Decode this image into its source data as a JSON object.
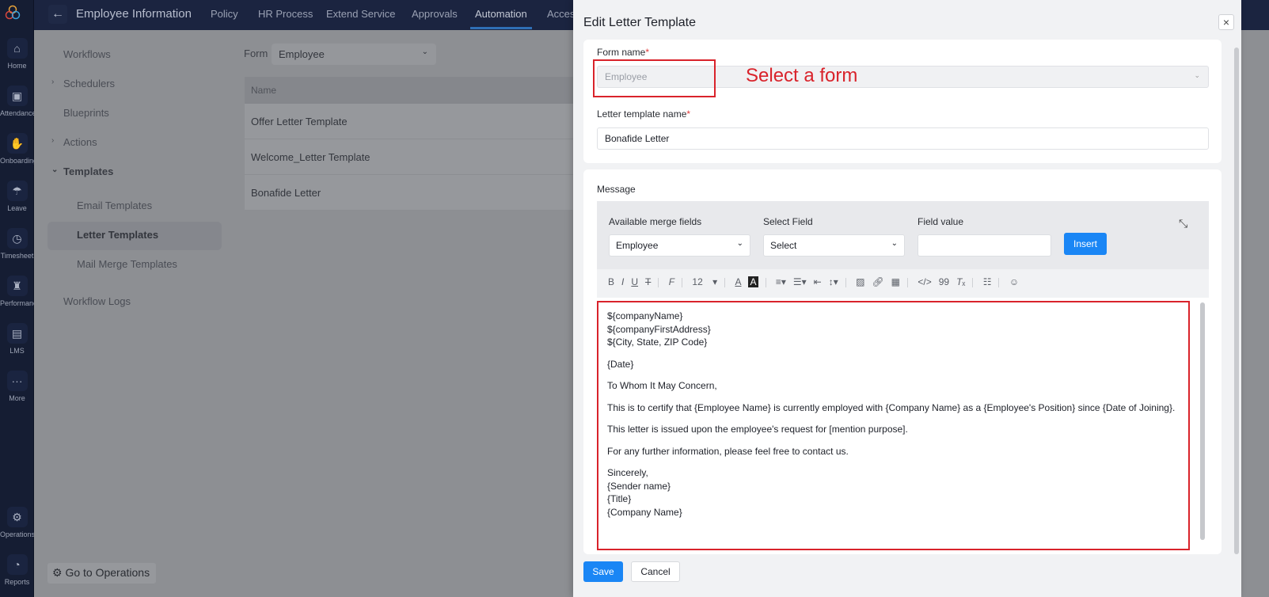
{
  "rail": [
    {
      "label": "Home",
      "icon": "home-icon",
      "glyph": "⌂"
    },
    {
      "label": "Attendance",
      "icon": "calendar-icon",
      "glyph": "▣"
    },
    {
      "label": "Onboarding",
      "icon": "handshake-icon",
      "glyph": "✋"
    },
    {
      "label": "Leave",
      "icon": "umbrella-icon",
      "glyph": "☂"
    },
    {
      "label": "Timesheet",
      "icon": "timer-icon",
      "glyph": "◷"
    },
    {
      "label": "Performance",
      "icon": "trophy-icon",
      "glyph": "♜"
    },
    {
      "label": "LMS",
      "icon": "lms-icon",
      "glyph": "▤"
    },
    {
      "label": "More",
      "icon": "more-icon",
      "glyph": "···"
    },
    {
      "label": "Operations",
      "icon": "operations-icon",
      "glyph": "⚙"
    },
    {
      "label": "Reports",
      "icon": "reports-icon",
      "glyph": "◔"
    }
  ],
  "topbar": {
    "title": "Employee Information",
    "tabs": [
      "Policy",
      "HR Process",
      "Extend Service",
      "Approvals",
      "Automation",
      "Access"
    ],
    "active": "Automation"
  },
  "nav": {
    "workflows": "Workflows",
    "schedulers": "Schedulers",
    "blueprints": "Blueprints",
    "actions": "Actions",
    "templates": "Templates",
    "email": "Email Templates",
    "letter": "Letter Templates",
    "mailmerge": "Mail Merge Templates",
    "logs": "Workflow Logs",
    "go_ops": "Go to Operations"
  },
  "main": {
    "form_label": "Form",
    "form_value": "Employee",
    "col_name": "Name",
    "rows": [
      "Offer Letter Template",
      "Welcome_Letter Template",
      "Bonafide Letter"
    ]
  },
  "modal": {
    "title": "Edit Letter Template",
    "form_name_label": "Form name",
    "form_name_value": "Employee",
    "annotation": "Select a form",
    "template_name_label": "Letter template name",
    "template_name_value": "Bonafide Letter",
    "message_label": "Message",
    "merge_label": "Available merge fields",
    "merge_value": "Employee",
    "select_field_label": "Select Field",
    "select_field_value": "Select",
    "field_value_label": "Field value",
    "field_value": "",
    "insert": "Insert",
    "font_size": "12",
    "body": [
      "${companyName}",
      "${companyFirstAddress}",
      "${City, State, ZIP Code}",
      "{Date}",
      "To Whom It May Concern,",
      "This is to certify that {Employee Name} is currently employed with {Company Name} as a {Employee's Position} since {Date of Joining}.",
      "This letter is issued upon the employee's request for [mention purpose].",
      "For any further information, please feel free to contact us.",
      "Sincerely,",
      "{Sender name}",
      "{Title}",
      "{Company Name}"
    ],
    "save": "Save",
    "cancel": "Cancel"
  },
  "colors": {
    "accent": "#1a86f5",
    "annotation": "#d9232b",
    "rail": "#151d33"
  }
}
